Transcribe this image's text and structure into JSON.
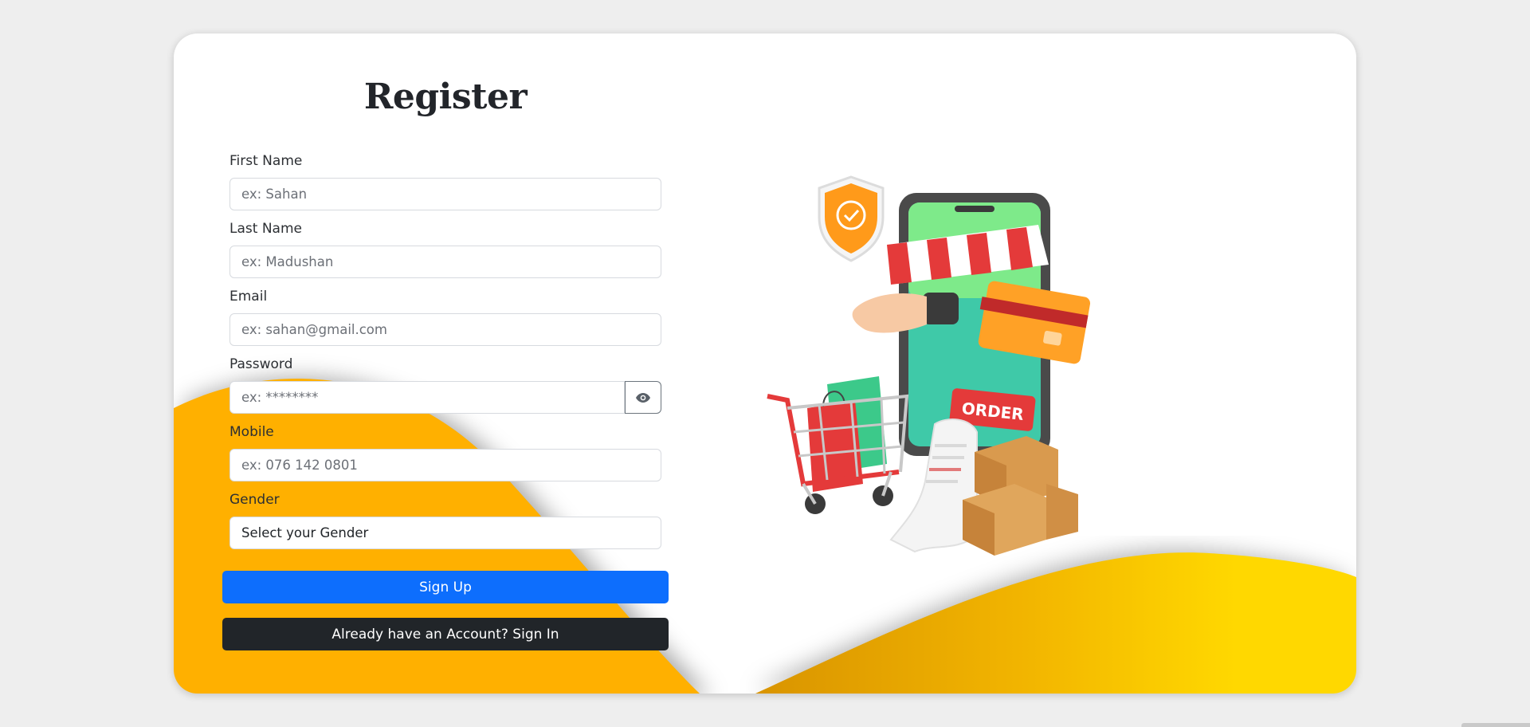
{
  "form": {
    "title": "Register",
    "first_name": {
      "label": "First Name",
      "placeholder": "ex: Sahan"
    },
    "last_name": {
      "label": "Last Name",
      "placeholder": "ex: Madushan"
    },
    "email": {
      "label": "Email",
      "placeholder": "ex: sahan@gmail.com"
    },
    "password": {
      "label": "Password",
      "placeholder": "ex: ********"
    },
    "mobile": {
      "label": "Mobile",
      "placeholder": "ex: 076 142 0801"
    },
    "gender": {
      "label": "Gender",
      "selected": "Select your Gender"
    },
    "signup_label": "Sign Up",
    "signin_label": "Already have an Account? Sign In"
  },
  "illustration": {
    "order_badge": "ORDER"
  },
  "colors": {
    "primary": "#0d6efd",
    "dark": "#212529",
    "wave_orange": "#ffb000",
    "wave_yellow": "#ffd800"
  },
  "icons": {
    "password_toggle": "eye-icon"
  }
}
